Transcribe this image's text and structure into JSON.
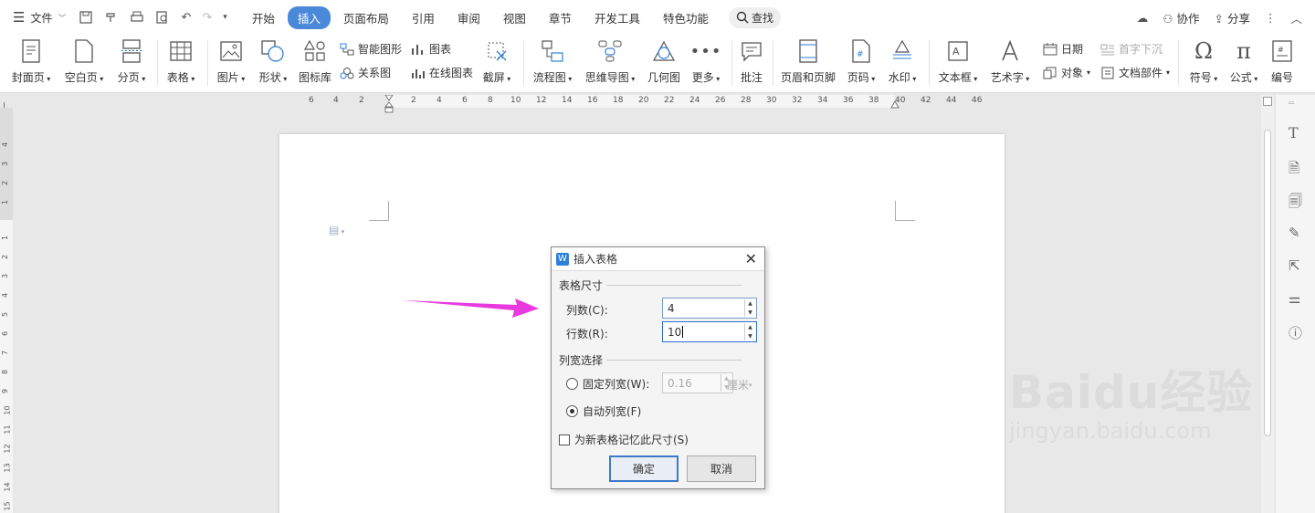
{
  "titlebar": {
    "menu_label": "文件",
    "tabs": [
      "开始",
      "插入",
      "页面布局",
      "引用",
      "审阅",
      "视图",
      "章节",
      "开发工具",
      "特色功能"
    ],
    "active_tab": "插入",
    "search_label": "查找",
    "collab_label": "协作",
    "share_label": "分享"
  },
  "ribbon": {
    "cover": "封面页",
    "blank": "空白页",
    "pagebreak": "分页",
    "table": "表格",
    "picture": "图片",
    "shape": "形状",
    "iconlib": "图标库",
    "smartart": "智能图形",
    "chart": "图表",
    "relation": "关系图",
    "onlinechart": "在线图表",
    "screenshot": "截屏",
    "flowchart": "流程图",
    "mindmap": "思维导图",
    "geometry": "几何图",
    "more": "更多",
    "comment": "批注",
    "headerfooter": "页眉和页脚",
    "pagenum": "页码",
    "watermark": "水印",
    "textbox": "文本框",
    "wordart": "艺术字",
    "date": "日期",
    "dropcap": "首字下沉",
    "object": "对象",
    "docparts": "文档部件",
    "symbol": "符号",
    "formula": "公式",
    "numbering": "编号"
  },
  "ruler": {
    "h": [
      "6",
      "4",
      "2",
      "2",
      "4",
      "6",
      "8",
      "10",
      "12",
      "14",
      "16",
      "18",
      "20",
      "22",
      "24",
      "26",
      "28",
      "30",
      "32",
      "34",
      "36",
      "38",
      "40",
      "42",
      "44",
      "46"
    ],
    "v": [
      "4",
      "3",
      "2",
      "1",
      "1",
      "2",
      "3",
      "4",
      "5",
      "6",
      "7",
      "8",
      "9",
      "10",
      "11",
      "12",
      "13",
      "14",
      "15"
    ]
  },
  "dialog": {
    "title": "插入表格",
    "size_section": "表格尺寸",
    "cols_label": "列数(C):",
    "cols_value": "4",
    "rows_label": "行数(R):",
    "rows_value": "10",
    "width_section": "列宽选择",
    "fixed_label": "固定列宽(W):",
    "fixed_value": "0.16",
    "fixed_unit": "厘米",
    "auto_label": "自动列宽(F)",
    "remember_label": "为新表格记忆此尺寸(S)",
    "ok_label": "确定",
    "cancel_label": "取消"
  },
  "watermark_text": {
    "brand": "Baidu经验",
    "url": "jingyan.baidu.com"
  },
  "colors": {
    "accent": "#4a88d9",
    "arrow": "#e83adf"
  }
}
